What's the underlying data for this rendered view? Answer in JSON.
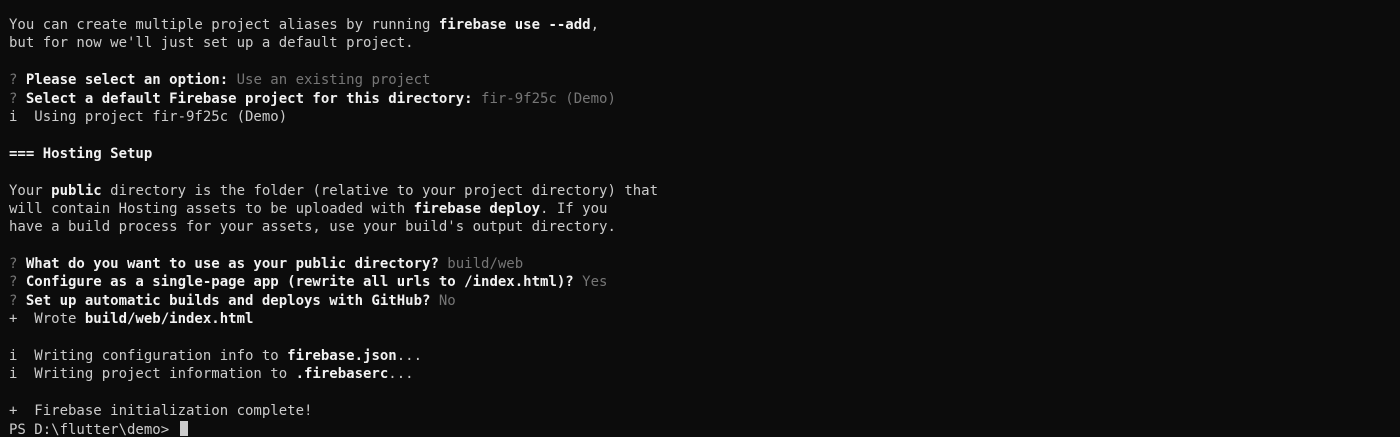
{
  "terminal": {
    "lines": {
      "l1": {
        "a": "You can create multiple project aliases by running ",
        "b": "firebase use --add",
        "c": ","
      },
      "l2": {
        "a": "but for now we'll just set up a default project."
      },
      "l4": {
        "q": "? ",
        "b": "Please select an option:",
        "v": " Use an existing project"
      },
      "l5": {
        "q": "? ",
        "b": "Select a default Firebase project for this directory:",
        "v": " fir-9f25c (Demo)"
      },
      "l6": {
        "a": "i  Using project fir-9f25c (Demo)"
      },
      "l8": {
        "b": "=== Hosting Setup"
      },
      "l10": {
        "a": "Your ",
        "b": "public",
        "c": " directory is the folder (relative to your project directory) that"
      },
      "l11": {
        "a": "will contain Hosting assets to be uploaded with ",
        "b": "firebase deploy",
        "c": ". If you"
      },
      "l12": {
        "a": "have a build process for your assets, use your build's output directory."
      },
      "l14": {
        "q": "? ",
        "b": "What do you want to use as your public directory?",
        "v": " build/web"
      },
      "l15": {
        "q": "? ",
        "b": "Configure as a single-page app (rewrite all urls to /index.html)?",
        "v": " Yes"
      },
      "l16": {
        "q": "? ",
        "b": "Set up automatic builds and deploys with GitHub?",
        "v": " No"
      },
      "l17": {
        "a": "+  Wrote ",
        "b": "build/web/index.html"
      },
      "l19": {
        "a": "i  Writing configuration info to ",
        "b": "firebase.json",
        "c": "..."
      },
      "l20": {
        "a": "i  Writing project information to ",
        "b": ".firebaserc",
        "c": "..."
      },
      "l22": {
        "a": "+  Firebase initialization complete!"
      },
      "prompt": {
        "a": "PS D:\\flutter\\demo> "
      }
    }
  },
  "colors": {
    "background": "#0c0c0c",
    "text": "#cccccc",
    "bold": "#f2f2f2",
    "answer": "#767676"
  }
}
